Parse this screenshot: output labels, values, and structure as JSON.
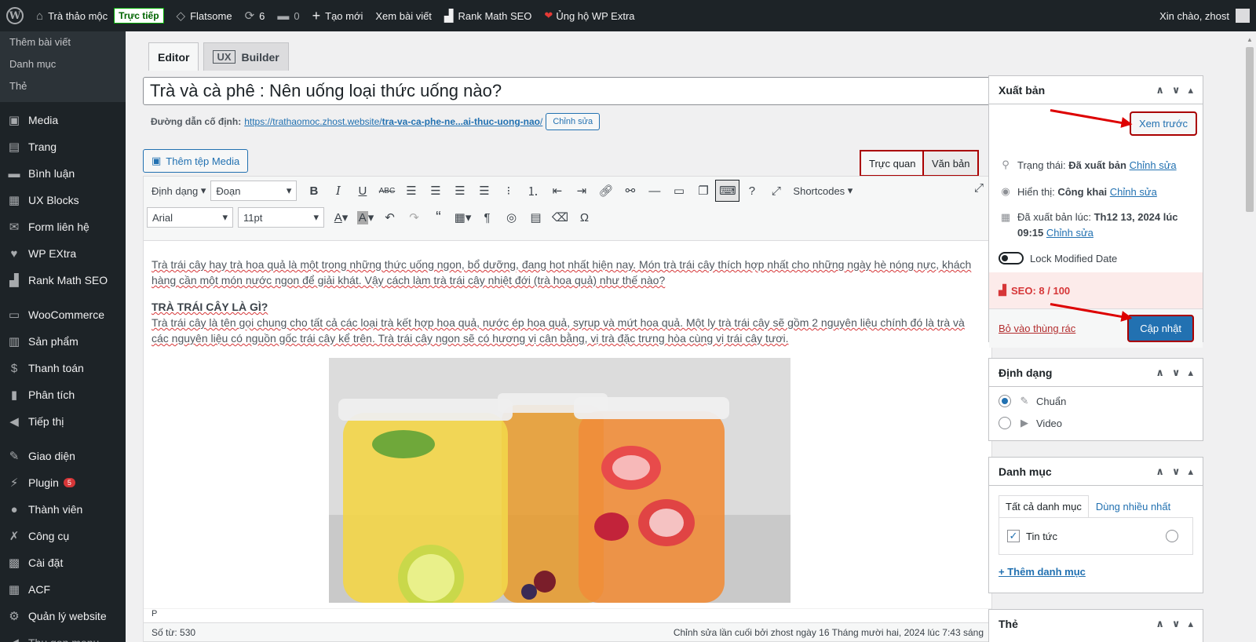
{
  "adminbar": {
    "site_name": "Trà thảo mộc",
    "live_badge": "Trực tiếp",
    "theme": "Flatsome",
    "updates_count": "6",
    "comments_count": "0",
    "new_label": "Tạo mới",
    "view_post": "Xem bài viết",
    "rank_math": "Rank Math SEO",
    "support": "Ủng hộ WP Extra",
    "greeting": "Xin chào, zhost"
  },
  "sidebar": {
    "submenu": [
      "Thêm bài viết",
      "Danh mục",
      "Thẻ"
    ],
    "items": [
      {
        "label": "Media",
        "icon": "media-icon",
        "glyph": "▣"
      },
      {
        "label": "Trang",
        "icon": "page-icon",
        "glyph": "▤"
      },
      {
        "label": "Bình luận",
        "icon": "comment-icon",
        "glyph": "▬"
      },
      {
        "label": "UX Blocks",
        "icon": "blocks-icon",
        "glyph": "▦"
      },
      {
        "label": "Form liên hệ",
        "icon": "mail-icon",
        "glyph": "✉"
      },
      {
        "label": "WP EXtra",
        "icon": "heart-icon",
        "glyph": "♥"
      },
      {
        "label": "Rank Math SEO",
        "icon": "chart-icon",
        "glyph": "▟"
      },
      {
        "label": "WooCommerce",
        "icon": "woo-icon",
        "glyph": "▭"
      },
      {
        "label": "Sản phẩm",
        "icon": "archive-icon",
        "glyph": "▥"
      },
      {
        "label": "Thanh toán",
        "icon": "dollar-icon",
        "glyph": "$"
      },
      {
        "label": "Phân tích",
        "icon": "bar-chart-icon",
        "glyph": "▮"
      },
      {
        "label": "Tiếp thị",
        "icon": "megaphone-icon",
        "glyph": "◀"
      },
      {
        "label": "Giao diện",
        "icon": "brush-icon",
        "glyph": "✎"
      },
      {
        "label": "Plugin",
        "icon": "plugin-icon",
        "glyph": "⚡",
        "badge": "5"
      },
      {
        "label": "Thành viên",
        "icon": "user-icon",
        "glyph": "●"
      },
      {
        "label": "Công cụ",
        "icon": "wrench-icon",
        "glyph": "✗"
      },
      {
        "label": "Cài đặt",
        "icon": "settings-icon",
        "glyph": "▩"
      },
      {
        "label": "ACF",
        "icon": "acf-icon",
        "glyph": "▦"
      },
      {
        "label": "Quản lý website",
        "icon": "gear-icon",
        "glyph": "⚙"
      },
      {
        "label": "Thu gọn menu",
        "icon": "collapse-icon",
        "glyph": "◀"
      }
    ]
  },
  "editor": {
    "tab_editor": "Editor",
    "tab_ux": "UX",
    "tab_builder": "Builder",
    "title": "Trà và cà phê : Nên uống loại thức uống nào?",
    "permalink_label": "Đường dẫn cố định:",
    "permalink_base": "https://trathaomoc.zhost.website/",
    "permalink_slug": "tra-va-ca-phe-ne...ai-thuc-uong-nao",
    "permalink_end": "/",
    "edit_btn": "Chỉnh sửa",
    "add_media": "Thêm tệp Media",
    "visual_tab": "Trực quan",
    "text_tab": "Văn bản",
    "format_select": "Định dạng",
    "paragraph_select": "Đoạn",
    "font_select": "Arial",
    "size_select": "11pt",
    "shortcodes": "Shortcodes",
    "para1": "Trà trái cây hay trà hoa quả là một trong những thức uống ngon, bổ dưỡng, đang hot nhất hiện nay. Món trà trái cây thích hợp nhất cho những ngày hè nóng nực, khách hàng cần một món nước ngon để giải khát. Vậy cách làm trà trái cây nhiệt đới (trà hoa quả) như thế nào?",
    "heading": "TRÀ TRÁI CÂY LÀ GÌ?",
    "para2": "Trà trái cây là tên gọi chung cho tất cả các loại trà kết hợp hoa quả, nước ép hoa quả, syrup và mứt hoa quả. Một ly trà trái cây sẽ gồm 2 nguyên liệu chính đó là trà và các nguyên liệu có nguồn gốc trái cây kể trên. Trà trái cây ngon sẽ có hương vị cân bằng, vị trà đặc trưng hòa cùng vị trái cây tươi.",
    "status_path": "P",
    "word_count": "Số từ: 530",
    "last_edit": "Chỉnh sửa lần cuối bởi zhost ngày 16 Tháng mười hai, 2024 lúc 7:43 sáng"
  },
  "publish": {
    "title": "Xuất bản",
    "preview": "Xem trước",
    "status_label": "Trạng thái:",
    "status_value": "Đã xuất bản",
    "visibility_label": "Hiển thị:",
    "visibility_value": "Công khai",
    "published_label": "Đã xuất bản lúc:",
    "published_value": "Th12 13, 2024 lúc",
    "published_time": "09:15",
    "edit_link": "Chỉnh sửa",
    "lock_label": "Lock Modified Date",
    "seo": "SEO: 8 / 100",
    "trash": "Bỏ vào thùng rác",
    "update": "Cập nhật"
  },
  "format_box": {
    "title": "Định dạng",
    "opt_standard": "Chuẩn",
    "opt_video": "Video"
  },
  "category_box": {
    "title": "Danh mục",
    "tab_all": "Tất cả danh mục",
    "tab_most": "Dùng nhiều nhất",
    "item": "Tin tức",
    "add": "+ Thêm danh mục"
  },
  "tags_box": {
    "title": "Thẻ"
  }
}
